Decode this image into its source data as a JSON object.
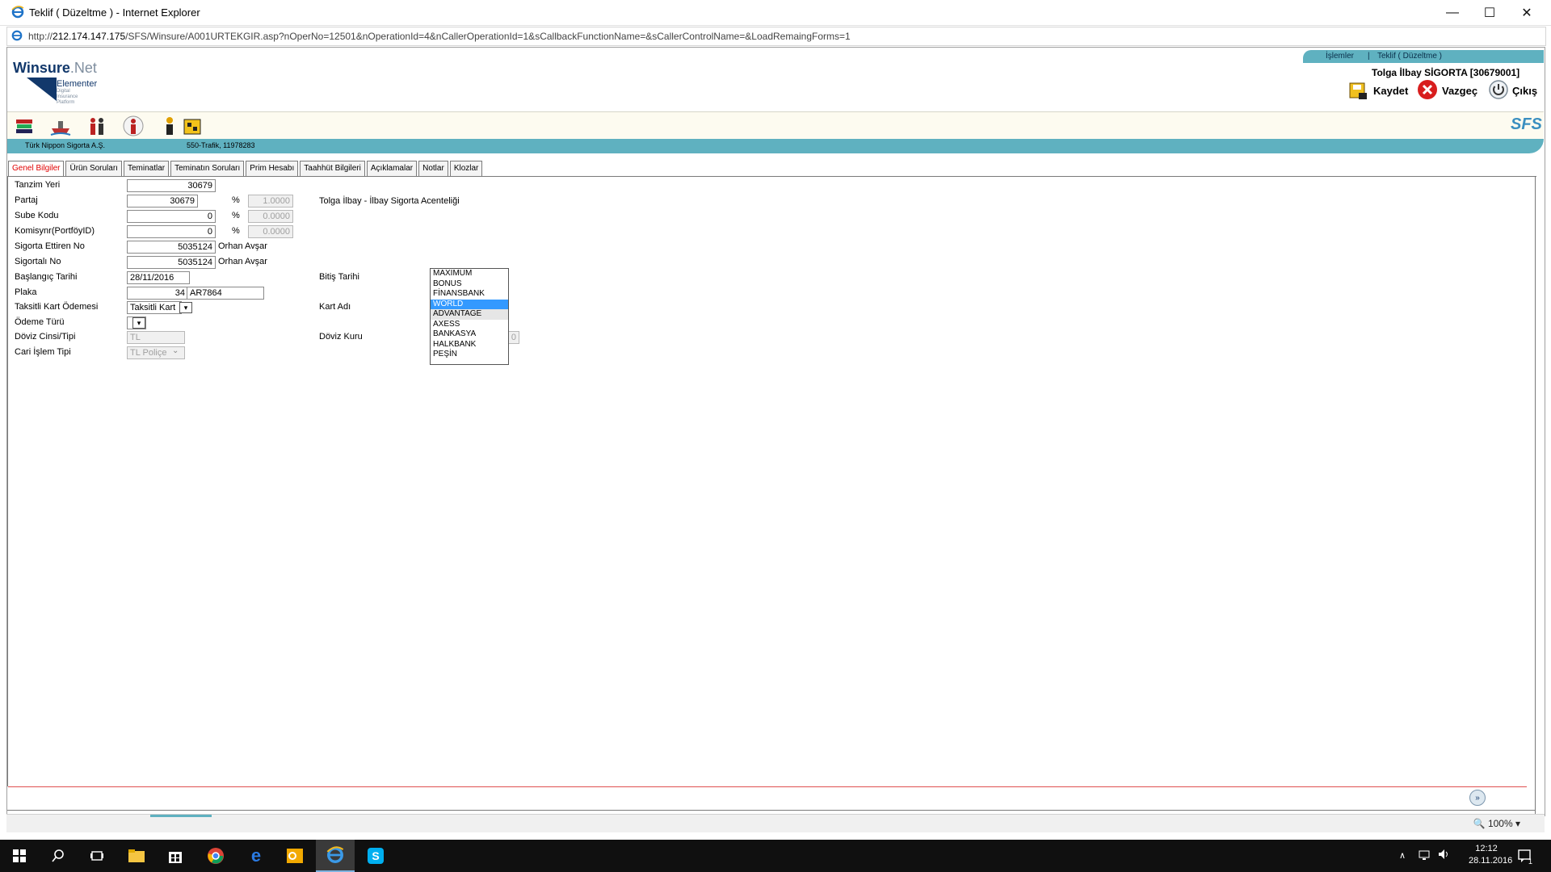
{
  "window": {
    "title": "Teklif ( Düzeltme ) - Internet Explorer",
    "controls": {
      "minimize": "—",
      "maximize": "☐",
      "close": "✕"
    }
  },
  "address": {
    "url_prefix": "http://",
    "url_host": "212.174.147.175",
    "url_path": "/SFS/Winsure/A001URTEKGIR.asp?nOperNo=12501&nOperationId=4&nCallerOperationId=1&sCallbackFunctionName=&sCallerControlName=&LoadRemaingForms=1"
  },
  "header": {
    "logo_brand": "Winsure",
    "logo_suffix": ".Net",
    "logo_sub": "Elementer",
    "logo_tagline": "Digital Insurance Platform",
    "nav_islemler": "İşlemler",
    "nav_sep": "|",
    "nav_teklif": "Teklif ( Düzeltme )",
    "user": "Tolga İlbay SİGORTA [30679001]",
    "save_label": "Kaydet",
    "cancel_label": "Vazgeç",
    "exit_label": "Çıkış"
  },
  "toolbar": {
    "brand": "SFS"
  },
  "infobar": {
    "company": "Türk Nippon Sigorta A.Ş.",
    "product": "550-Trafik, 11978283"
  },
  "tabs": [
    "Genel Bilgiler",
    "Ürün Soruları",
    "Teminatlar",
    "Teminatın Soruları",
    "Prim Hesabı",
    "Taahhüt Bilgileri",
    "Açıklamalar",
    "Notlar",
    "Klozlar"
  ],
  "form": {
    "tanzim_yeri": {
      "label": "Tanzim Yeri",
      "value": "30679"
    },
    "partaj": {
      "label": "Partaj",
      "value": "30679",
      "pct": "%",
      "rate": "1.0000",
      "desc": "Tolga İlbay - İlbay Sigorta Acenteliği"
    },
    "sube_kodu": {
      "label": "Sube Kodu",
      "value": "0",
      "pct": "%",
      "rate": "0.0000"
    },
    "komisyoncu": {
      "label": "Komisynr(PortföyID)",
      "value": "0",
      "pct": "%",
      "rate": "0.0000"
    },
    "sigorta_ettiren": {
      "label": "Sigorta Ettiren No",
      "value": "5035124",
      "name": "Orhan Avşar"
    },
    "sigortali": {
      "label": "Sigortalı No",
      "value": "5035124",
      "name": "Orhan Avşar"
    },
    "baslangic": {
      "label": "Başlangıç Tarihi",
      "value": "28/11/2016"
    },
    "bitis": {
      "label": "Bitiş Tarihi"
    },
    "plaka": {
      "label": "Plaka",
      "il": "34",
      "no": "AR7864"
    },
    "taksitli": {
      "label": "Taksitli Kart Ödemesi",
      "value": "Taksitli Kart"
    },
    "kart_adi": {
      "label": "Kart Adı"
    },
    "odeme": {
      "label": "Ödeme Türü",
      "value": ""
    },
    "doviz": {
      "label": "Döviz Cinsi/Tipi",
      "value": "TL"
    },
    "doviz_kuru": {
      "label": "Döviz Kuru",
      "value": "0"
    },
    "cari": {
      "label": "Cari İşlem Tipi",
      "value": "TL Poliçe"
    }
  },
  "card_options": [
    "MAXIMUM",
    "BONUS",
    "FİNANSBANK",
    "WORLD",
    "ADVANTAGE",
    "AXESS",
    "BANKASYA",
    "HALKBANK",
    "PEŞİN"
  ],
  "card_selected": "WORLD",
  "card_hover": "ADVANTAGE",
  "status": {
    "zoom": "100%"
  },
  "taskbar": {
    "time": "12:12",
    "date": "28.11.2016",
    "notif_count": "1"
  },
  "colors": {
    "teal": "#5fb1c0",
    "navy": "#12386b",
    "active_tab": "#e00000",
    "select_highlight": "#3399ff"
  }
}
